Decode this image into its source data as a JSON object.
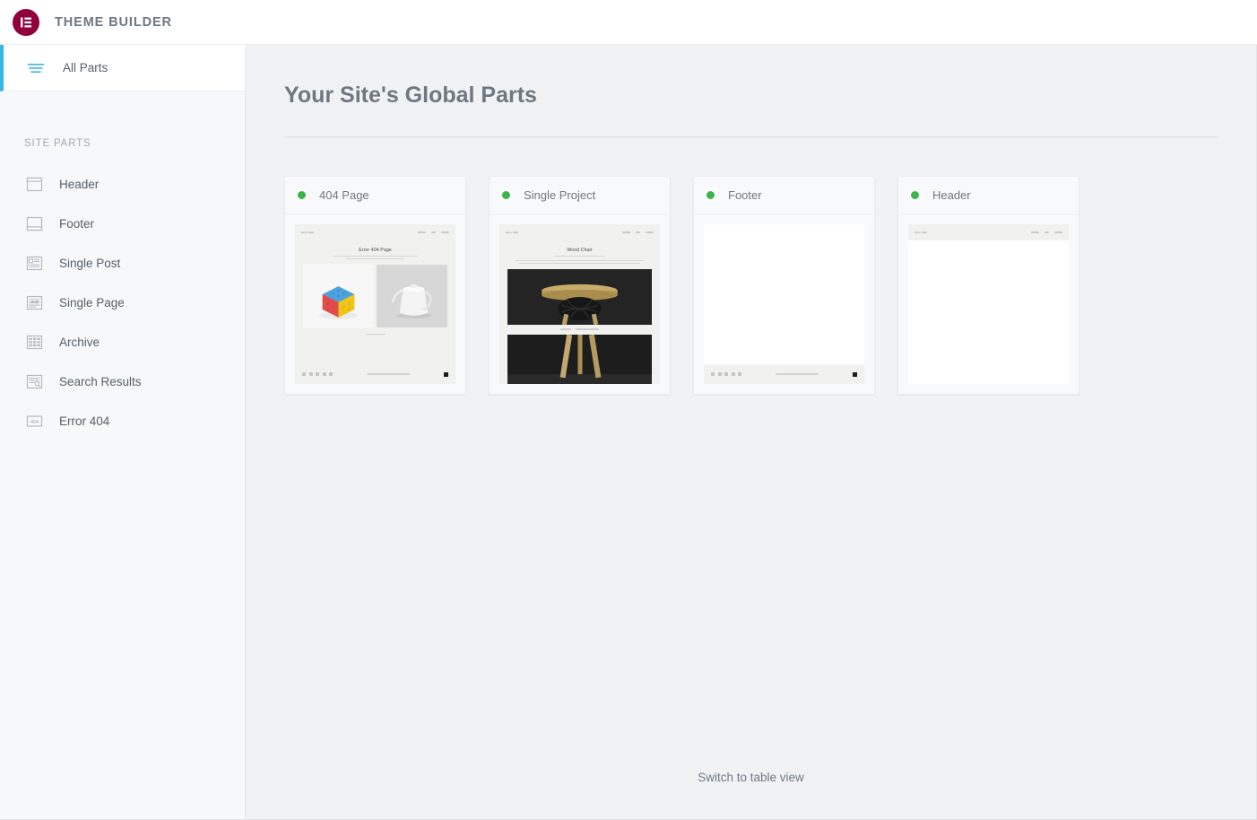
{
  "app": {
    "title": "THEME BUILDER",
    "logo_icon": "elementor-logo-icon",
    "brand_color": "#92003b",
    "accent_color": "#39b6e8",
    "status_color": "#39b54a"
  },
  "sidebar": {
    "all_parts": {
      "label": "All Parts",
      "icon": "filter-lines-icon",
      "active": true
    },
    "section_label": "SITE PARTS",
    "items": [
      {
        "label": "Header",
        "icon": "header-layout-icon"
      },
      {
        "label": "Footer",
        "icon": "footer-layout-icon"
      },
      {
        "label": "Single Post",
        "icon": "single-post-icon"
      },
      {
        "label": "Single Page",
        "icon": "single-page-icon"
      },
      {
        "label": "Archive",
        "icon": "archive-grid-icon"
      },
      {
        "label": "Search Results",
        "icon": "search-results-icon"
      },
      {
        "label": "Error 404",
        "icon": "error-404-icon"
      }
    ]
  },
  "main": {
    "heading": "Your Site's Global Parts",
    "switch_view_label": "Switch to table view",
    "cards": [
      {
        "name": "404 Page",
        "status": "published",
        "status_icon": "green-dot-icon",
        "preview": {
          "kind": "error-404-preview",
          "logo_text": "Hero Spot",
          "title": "Error 404 Page",
          "menu_items": 3
        }
      },
      {
        "name": "Single Project",
        "status": "published",
        "status_icon": "green-dot-icon",
        "preview": {
          "kind": "single-project-preview",
          "logo_text": "Hero Spot",
          "title": "Wood Chair",
          "menu_items": 3
        }
      },
      {
        "name": "Footer",
        "status": "published",
        "status_icon": "green-dot-icon",
        "preview": {
          "kind": "footer-preview",
          "logo_text": "",
          "title": "",
          "menu_items": 0
        }
      },
      {
        "name": "Header",
        "status": "published",
        "status_icon": "green-dot-icon",
        "preview": {
          "kind": "header-preview",
          "logo_text": "Hero Spot",
          "title": "",
          "menu_items": 3
        }
      }
    ]
  }
}
